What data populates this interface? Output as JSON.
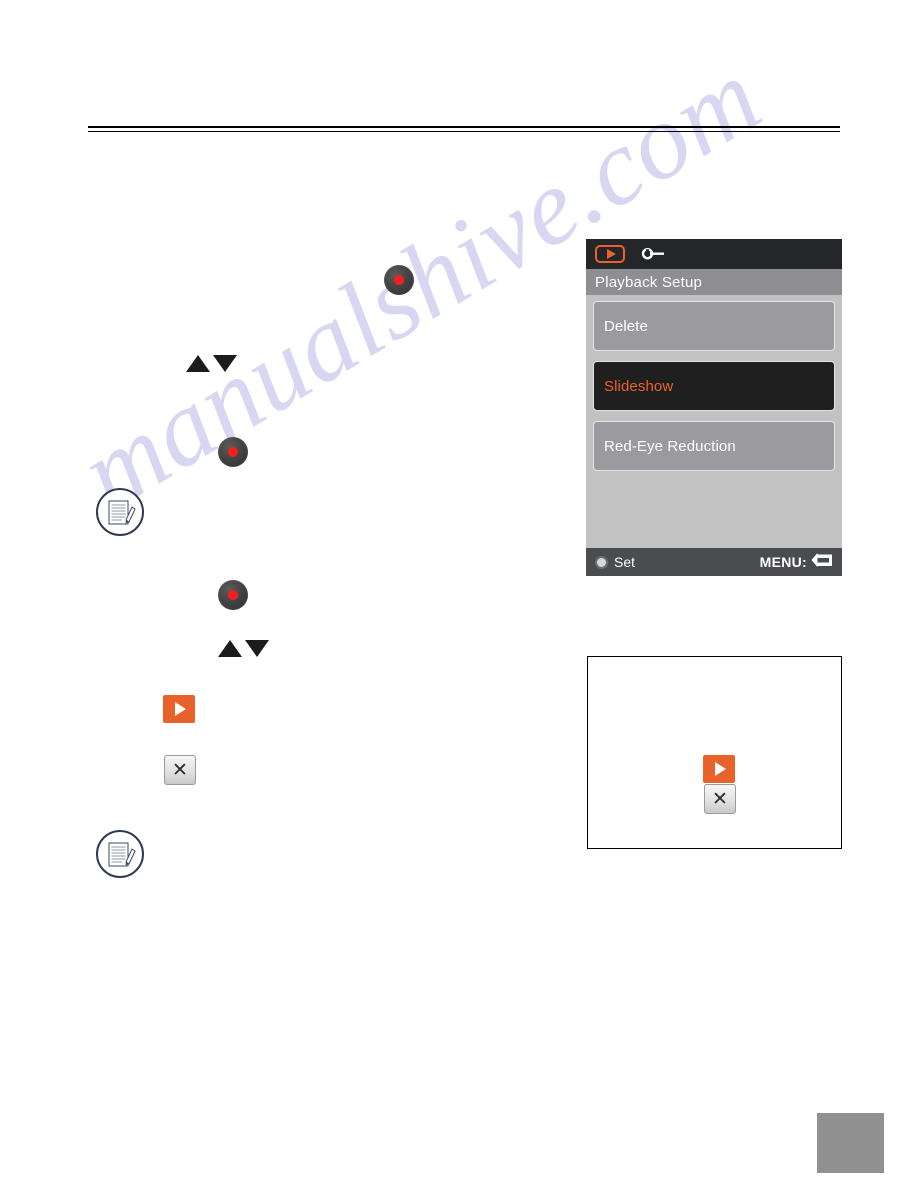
{
  "page": {
    "watermark_text": "manualshive.com",
    "background_color": "#ffffff",
    "accent_color": "#e8622a"
  },
  "header": {
    "rule_style": "double-horizontal-rule"
  },
  "body_icons": [
    {
      "name": "set-button-icon",
      "label": "SET button",
      "type": "round-red-center-button"
    },
    {
      "name": "up-down-arrows-icon",
      "label": "Up / Down arrows",
      "type": "triangle-pair"
    },
    {
      "name": "set-button-icon-2",
      "label": "SET button",
      "type": "round-red-center-button"
    },
    {
      "name": "note-icon-1",
      "label": "Note",
      "type": "circled-memo-pencil"
    },
    {
      "name": "set-button-icon-3",
      "label": "SET button",
      "type": "round-red-center-button"
    },
    {
      "name": "up-down-arrows-icon-2",
      "label": "Up / Down arrows",
      "type": "triangle-pair"
    },
    {
      "name": "play-icon",
      "label": "Play",
      "type": "orange-play-chip"
    },
    {
      "name": "stop-icon",
      "label": "Stop",
      "type": "gray-x-chip"
    },
    {
      "name": "note-icon-2",
      "label": "Note",
      "type": "circled-memo-pencil"
    }
  ],
  "lcd": {
    "tabs": [
      {
        "name": "playback-tab",
        "label": "Playback",
        "icon": "play-icon",
        "selected": true
      },
      {
        "name": "setup-tab",
        "label": "Setup",
        "icon": "wrench-icon",
        "selected": false
      }
    ],
    "title": "Playback Setup",
    "menu_items": [
      {
        "label": "Delete",
        "selected": false
      },
      {
        "label": "Slideshow",
        "selected": true
      },
      {
        "label": "Red-Eye Reduction",
        "selected": false
      }
    ],
    "footer": {
      "set_label": "Set",
      "menu_label": "MENU:",
      "menu_icon": "return-arrow-icon"
    },
    "colors": {
      "tab_bar": "#25262a",
      "title_bar": "#8e8e93",
      "body": "#c2c2c2",
      "row_normal": "#9b9b9f",
      "row_selected": "#201f1f",
      "selected_text": "#e8622a",
      "footer": "#4b4c50"
    }
  },
  "illustration_box": {
    "icons": [
      {
        "name": "play-icon",
        "label": "Play",
        "type": "orange-play-chip"
      },
      {
        "name": "stop-icon",
        "label": "Stop",
        "type": "gray-x-chip"
      }
    ]
  },
  "page_tab": {
    "label": ""
  }
}
